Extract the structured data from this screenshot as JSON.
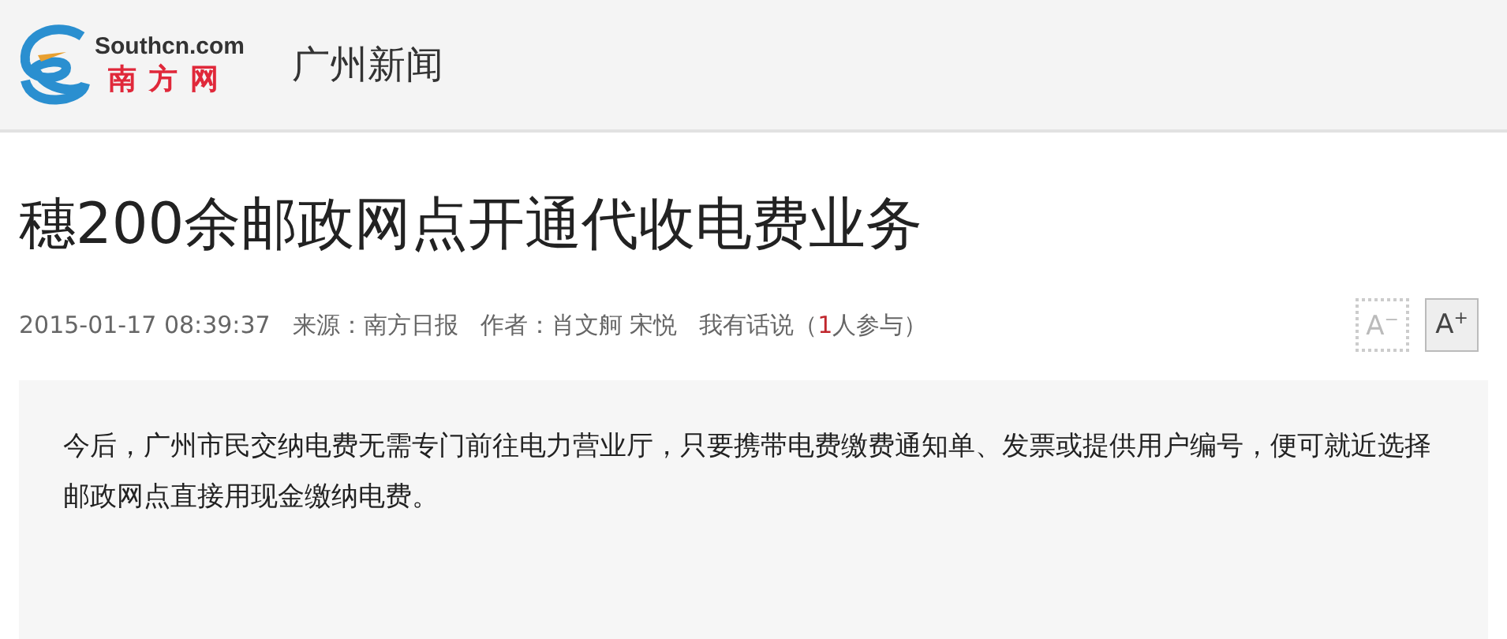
{
  "header": {
    "logo": {
      "domain": "Southcn.com",
      "name": "南方网"
    },
    "section": "广州新闻"
  },
  "article": {
    "title": "穗200余邮政网点开通代收电费业务",
    "meta": {
      "datetime": "2015-01-17 08:39:37",
      "source_label": "来源：",
      "source": "南方日报",
      "author_label": "作者：",
      "authors": "肖文舸 宋悦",
      "comments_prefix": "我有话说（",
      "comments_count": "1",
      "comments_suffix": "人参与）"
    },
    "font_buttons": [
      {
        "letter": "A",
        "sign": "−",
        "disabled": true
      },
      {
        "letter": "A",
        "sign": "+",
        "disabled": false
      }
    ],
    "summary": "今后，广州市民交纳电费无需专门前往电力营业厅，只要携带电费缴费通知单、发票或提供用户编号，便可就近选择邮政网点直接用现金缴纳电费。"
  }
}
